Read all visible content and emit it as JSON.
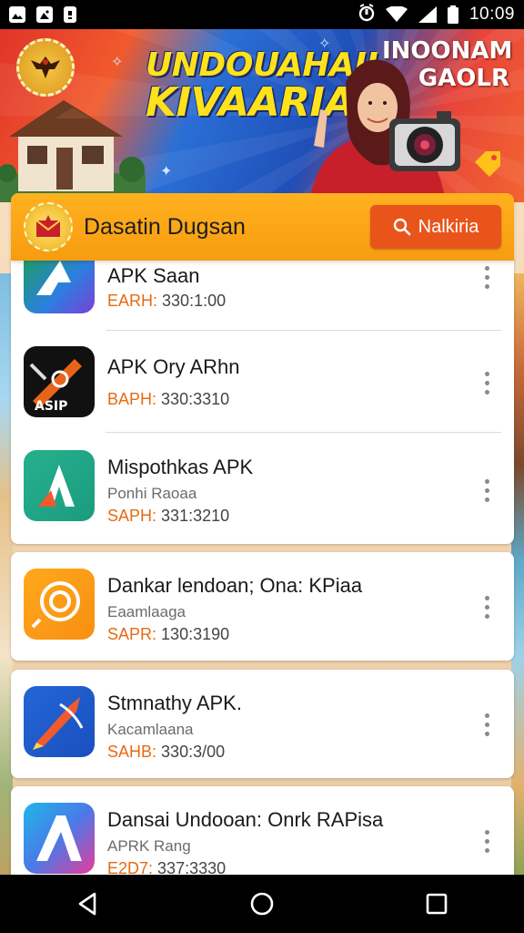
{
  "status_bar": {
    "time": "10:09",
    "left_icons": [
      "gallery-icon",
      "image-icon",
      "notification-icon"
    ],
    "right_icons": [
      "alarm-icon",
      "wifi-icon",
      "signal-icon",
      "battery-icon"
    ]
  },
  "banner": {
    "title_line1": "UNDOUAHAII",
    "title_line2": "KIVAARIA",
    "right_text_line1": "INOONAM",
    "right_text_line2": "GAOLR"
  },
  "header": {
    "title": "Dasatin Dugsan",
    "button_label": "Nalkiria"
  },
  "apps": [
    {
      "name": "APK Saan",
      "subtitle": "",
      "meta_key": "EARH:",
      "meta_value": "330:1:00",
      "icon": "blue-arrow-app-icon"
    },
    {
      "name": "APK Ory ARhn",
      "subtitle": "",
      "meta_key": "BAPH:",
      "meta_value": "330:3310",
      "icon": "hammer-app-icon"
    },
    {
      "name": "Mispothkas APK",
      "subtitle": "Ponhi Raoaa",
      "meta_key": "SAPH:",
      "meta_value": "331:3210",
      "icon": "letter-a-app-icon"
    },
    {
      "name": "Dankar lendoan; Ona: KPiaa",
      "subtitle": "Eaamlaaga",
      "meta_key": "SAPR:",
      "meta_value": "130:3190",
      "icon": "spiral-app-icon"
    },
    {
      "name": "Stmnathy APK.",
      "subtitle": "Kacamlaana",
      "meta_key": "SAHB:",
      "meta_value": "330:3/00",
      "icon": "pencil-app-icon"
    },
    {
      "name": "Dansai Undooan: Onrk RAPisa",
      "subtitle": "APRK Rang",
      "meta_key": "E2D7:",
      "meta_value": "337:3330",
      "icon": "gradient-a-app-icon"
    }
  ],
  "nav_bar": {
    "buttons": [
      "back-icon",
      "home-icon",
      "recents-icon"
    ]
  },
  "colors": {
    "header_orange": "#f79c10",
    "button_orange": "#e9541b",
    "meta_orange": "#e66a12"
  }
}
